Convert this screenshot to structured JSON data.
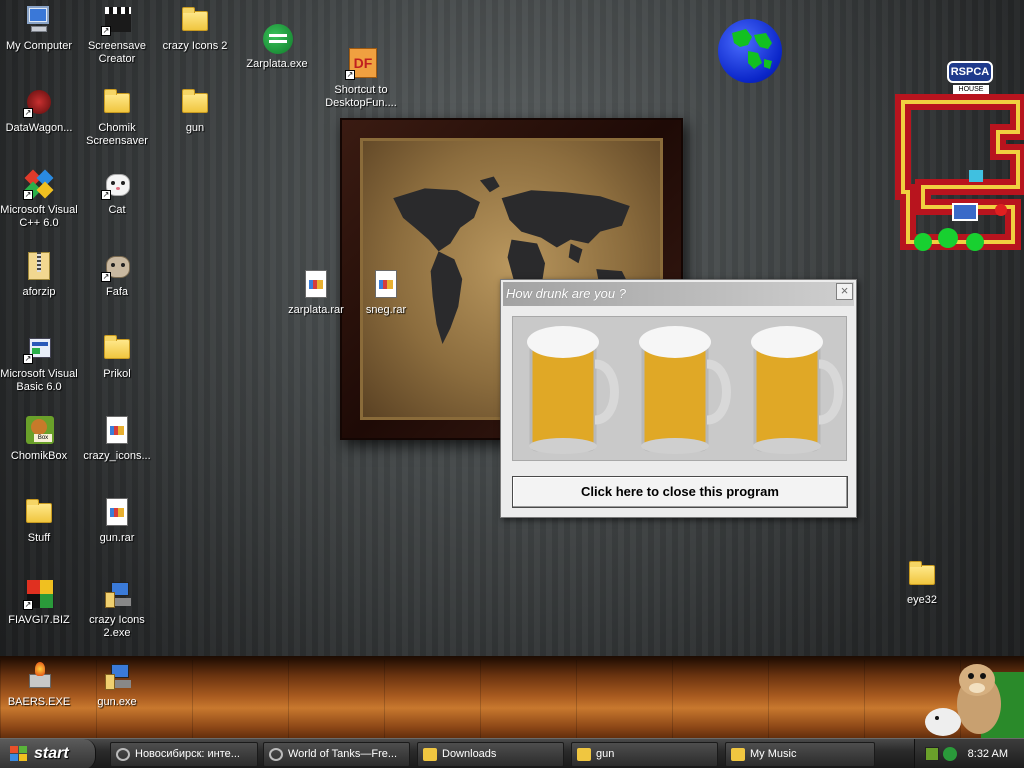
{
  "desktop_icons": [
    {
      "label": "My Computer"
    },
    {
      "label": "Screensave Creator"
    },
    {
      "label": "crazy Icons 2"
    },
    {
      "label": "Zarplata.exe"
    },
    {
      "label": "Shortcut to DesktopFun...."
    },
    {
      "label": "DataWagon..."
    },
    {
      "label": "Chomik Screensaver"
    },
    {
      "label": "gun"
    },
    {
      "label": "Microsoft Visual C++ 6.0"
    },
    {
      "label": "Cat"
    },
    {
      "label": "aforzip"
    },
    {
      "label": "Fafa"
    },
    {
      "label": "zarplata.rar"
    },
    {
      "label": "sneg.rar"
    },
    {
      "label": "Microsoft Visual Basic 6.0"
    },
    {
      "label": "Prikol"
    },
    {
      "label": "ChomikBox"
    },
    {
      "label": "crazy_icons..."
    },
    {
      "label": "Stuff"
    },
    {
      "label": "gun.rar"
    },
    {
      "label": "FIAVGI7.BIZ"
    },
    {
      "label": "crazy Icons 2.exe"
    },
    {
      "label": "BAERS.EXE"
    },
    {
      "label": "gun.exe"
    },
    {
      "label": "eye32"
    }
  ],
  "dialog": {
    "title": "How drunk are you ?",
    "close_glyph": "×",
    "close_program_label": "Click here to close this program"
  },
  "widgets": {
    "rspca_label": "RSPCA",
    "house_label": "HOUSE"
  },
  "taskbar": {
    "start_label": "start",
    "tasks": [
      {
        "label": "Новосибирск: инте..."
      },
      {
        "label": "World of Tanks—Fre..."
      },
      {
        "label": "Downloads"
      },
      {
        "label": "gun"
      },
      {
        "label": "My Music"
      }
    ],
    "clock": "8:32 AM"
  },
  "colors": {
    "dialog_title_start": "#a2a2a2",
    "dialog_title_end": "#cfcfcf",
    "taskbar": "#2b2b2b",
    "globe_ocean": "#0a25c8",
    "globe_land": "#12c021"
  }
}
